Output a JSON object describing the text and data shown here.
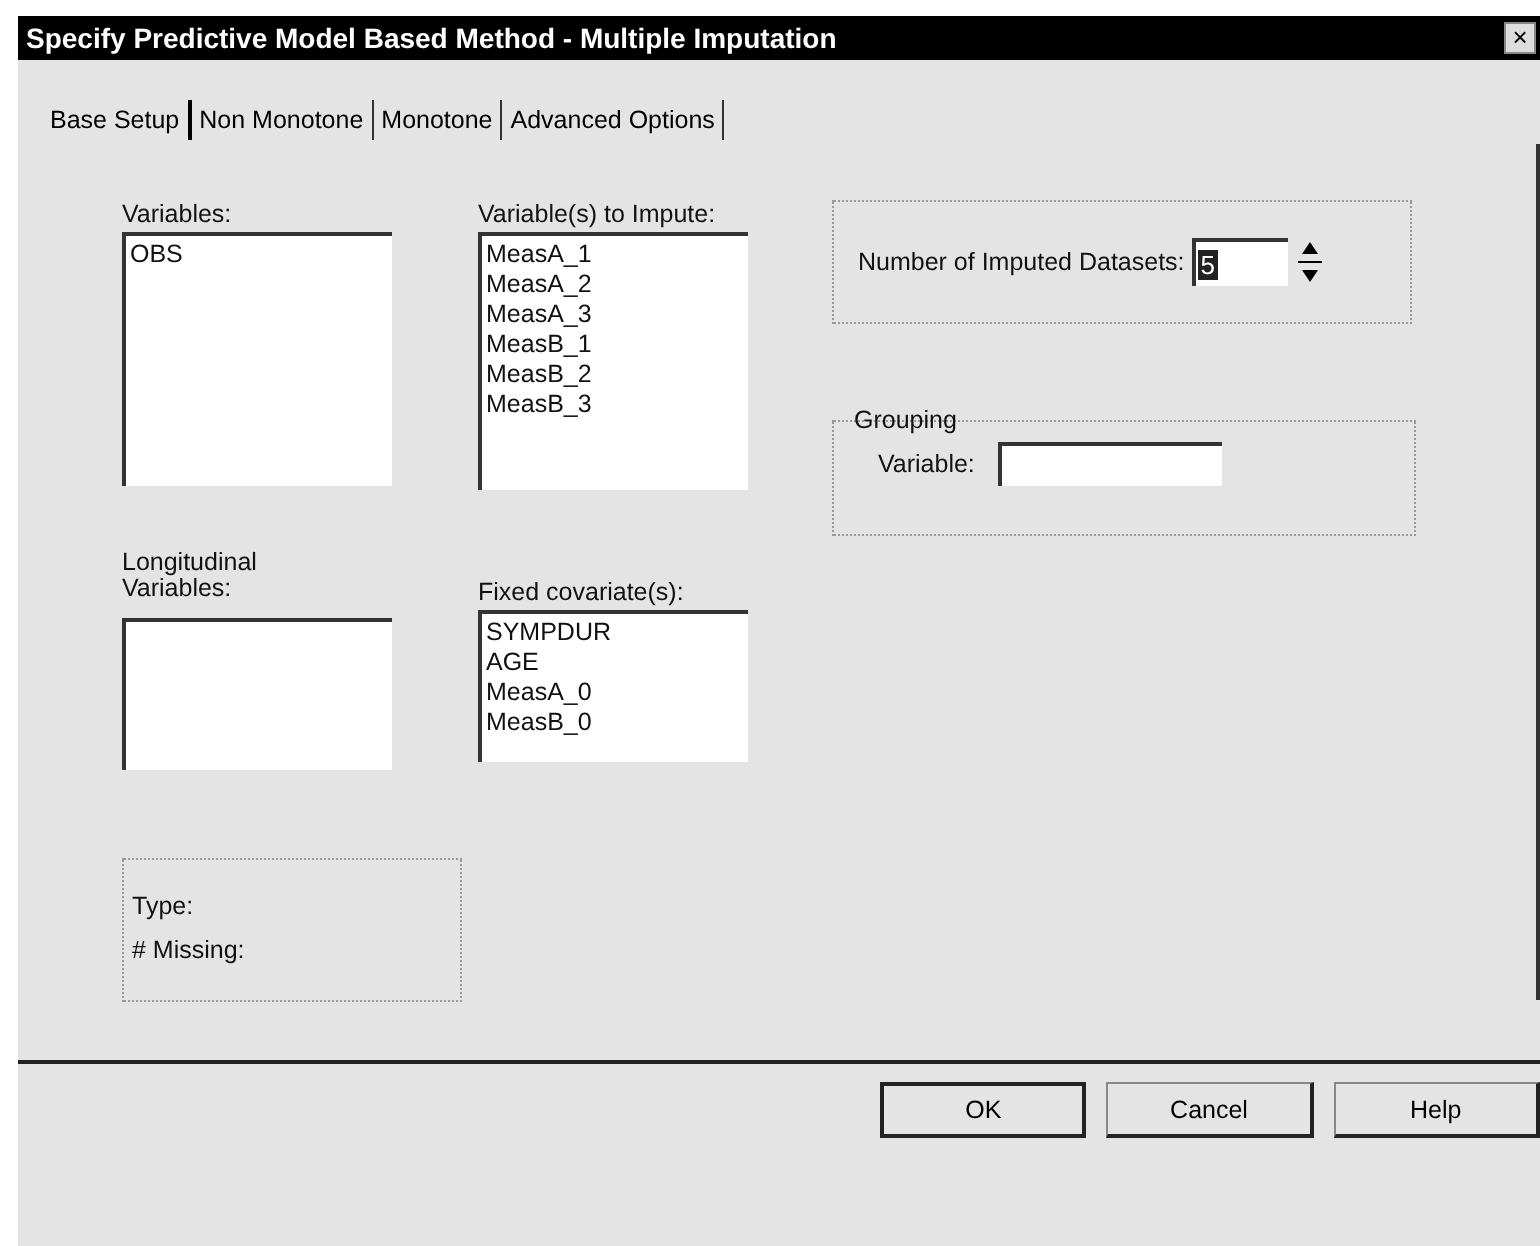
{
  "window": {
    "title": "Specify Predictive Model Based Method - Multiple Imputation",
    "close": "×"
  },
  "tabs": [
    {
      "label": "Base Setup",
      "selected": true
    },
    {
      "label": "Non Monotone",
      "selected": false
    },
    {
      "label": "Monotone",
      "selected": false
    },
    {
      "label": "Advanced Options",
      "selected": false
    }
  ],
  "variables": {
    "label": "Variables:",
    "items": [
      "OBS"
    ]
  },
  "impute": {
    "label": "Variable(s) to Impute:",
    "items": [
      "MeasA_1",
      "MeasA_2",
      "MeasA_3",
      "MeasB_1",
      "MeasB_2",
      "MeasB_3"
    ]
  },
  "datasets": {
    "label": "Number of Imputed Datasets:",
    "value": "5"
  },
  "grouping": {
    "title": "Grouping",
    "label": "Variable:"
  },
  "longitudinal": {
    "label": "Longitudinal Variables:"
  },
  "fixed": {
    "label": "Fixed covariate(s):",
    "items": [
      "SYMPDUR",
      "AGE",
      "MeasA_0",
      "MeasB_0"
    ]
  },
  "step": {
    "type_label": "Type:",
    "missing_label": "# Missing:"
  },
  "buttons": [
    "OK",
    "Cancel",
    "Help"
  ]
}
